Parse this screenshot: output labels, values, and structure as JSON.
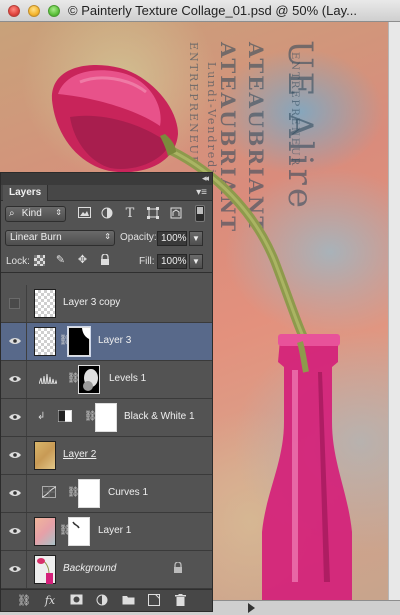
{
  "window": {
    "title": "© Painterly Texture Collage_01.psd @ 50% (Lay..."
  },
  "canvas": {
    "texts": [
      "ENTREPRENEUR",
      "ATEAUBRIANT",
      "ATEAUBRIANT",
      "UE Alire",
      "Lundi-Vendredi",
      "ENTREPRENEUR"
    ]
  },
  "panel": {
    "tab_label": "Layers",
    "menu_glyph": "▾≡",
    "collapse_glyph": "◂◂",
    "filter": {
      "kind_label": "Kind",
      "icons": [
        "image-filter-icon",
        "adjustment-filter-icon",
        "type-filter-icon",
        "shape-filter-icon",
        "smart-object-filter-icon"
      ]
    },
    "blend_mode": "Linear Burn",
    "opacity_label": "Opacity:",
    "opacity_value": "100%",
    "lock_label": "Lock:",
    "fill_label": "Fill:",
    "fill_value": "100%",
    "layers": [
      {
        "name": "Layer 3 copy",
        "visible": false,
        "selected": false,
        "type": "pixel",
        "has_mask": false
      },
      {
        "name": "Layer 3",
        "visible": true,
        "selected": true,
        "type": "pixel",
        "has_mask": true
      },
      {
        "name": "Levels 1",
        "visible": true,
        "selected": false,
        "type": "adjustment",
        "has_mask": true
      },
      {
        "name": "Black & White 1",
        "visible": true,
        "selected": false,
        "type": "adjustment",
        "has_mask": true,
        "clipped": true
      },
      {
        "name": "Layer 2",
        "visible": true,
        "selected": false,
        "type": "pixel",
        "has_mask": false
      },
      {
        "name": "Curves 1",
        "visible": true,
        "selected": false,
        "type": "adjustment",
        "has_mask": true
      },
      {
        "name": "Layer 1",
        "visible": true,
        "selected": false,
        "type": "pixel",
        "has_mask": true
      },
      {
        "name": "Background",
        "visible": true,
        "selected": false,
        "type": "background",
        "has_mask": false,
        "locked": true
      }
    ],
    "footer_icons": [
      "link-layers-icon",
      "fx-icon",
      "add-mask-icon",
      "new-adjustment-icon",
      "new-group-icon",
      "new-layer-icon",
      "delete-layer-icon"
    ]
  },
  "colors": {
    "panel_bg": "#535353",
    "selected_row": "#58698a",
    "tulip": "#d8306a",
    "bottle": "#d4207a"
  }
}
